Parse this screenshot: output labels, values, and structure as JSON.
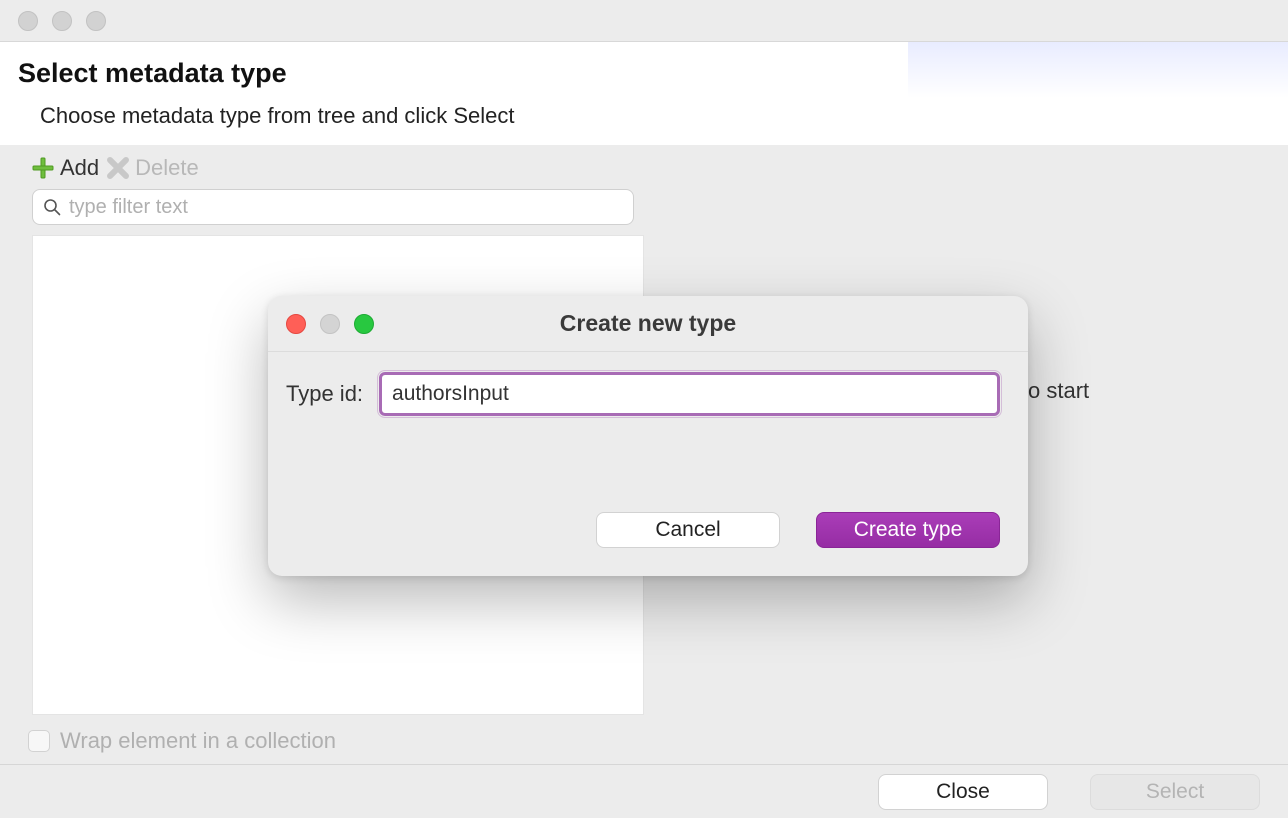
{
  "header": {
    "title": "Select metadata type",
    "subtitle": "Choose metadata type from tree and click Select"
  },
  "toolbar": {
    "add_label": "Add",
    "delete_label": "Delete"
  },
  "filter": {
    "placeholder": "type filter text"
  },
  "right_hint": "o start",
  "checkbox": {
    "label": "Wrap element in a collection"
  },
  "footer": {
    "close_label": "Close",
    "select_label": "Select"
  },
  "modal": {
    "title": "Create new type",
    "field_label": "Type id:",
    "field_value": "authorsInput",
    "cancel_label": "Cancel",
    "create_label": "Create type"
  }
}
